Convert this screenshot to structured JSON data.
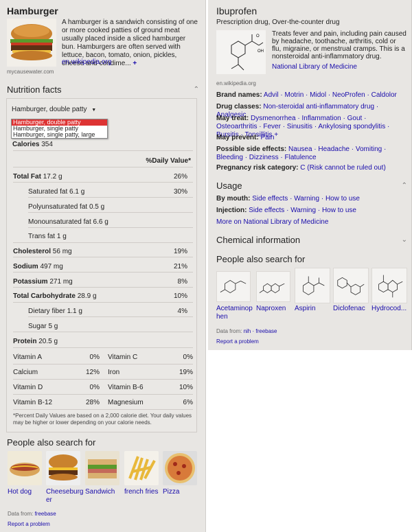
{
  "left": {
    "title": "Hamburger",
    "description": "A hamburger is a sandwich consisting of one or more cooked patties of ground meat usually placed inside a sliced hamburger bun. Hamburgers are often served with lettuce, bacon, tomato, onion, pickles, cheese and condime...",
    "more": "+",
    "image_credit": "mycausewater.com",
    "source_link": "en.wikipedia.org",
    "nutrition_title": "Nutrition facts",
    "serving_selected": "Hamburger, double patty",
    "serving_options": [
      "Hamburger, double patty",
      "Hamburger, single patty",
      "Hamburger, single patty, large"
    ],
    "calories_label": "Calories",
    "calories_value": "354",
    "daily_value_header": "%Daily Value*",
    "rows": [
      {
        "label": "Total Fat",
        "amount": "17.2 g",
        "pct": "26%"
      },
      {
        "label": "Saturated fat",
        "amount": "6.1 g",
        "pct": "30%"
      },
      {
        "label": "Polyunsaturated fat",
        "amount": "0.5 g",
        "pct": ""
      },
      {
        "label": "Monounsaturated fat",
        "amount": "6.6 g",
        "pct": ""
      },
      {
        "label": "Trans fat",
        "amount": "1 g",
        "pct": ""
      },
      {
        "label": "Cholesterol",
        "amount": "56 mg",
        "pct": "19%"
      },
      {
        "label": "Sodium",
        "amount": "497 mg",
        "pct": "21%"
      },
      {
        "label": "Potassium",
        "amount": "271 mg",
        "pct": "8%"
      },
      {
        "label": "Total Carbohydrate",
        "amount": "28.9 g",
        "pct": "10%"
      },
      {
        "label": "Dietary fiber",
        "amount": "1.1 g",
        "pct": "4%"
      },
      {
        "label": "Sugar",
        "amount": "5 g",
        "pct": ""
      },
      {
        "label": "Protein",
        "amount": "20.5 g",
        "pct": ""
      }
    ],
    "vitamins": [
      [
        "Vitamin A",
        "0%",
        "Vitamin C",
        "0%"
      ],
      [
        "Calcium",
        "12%",
        "Iron",
        "19%"
      ],
      [
        "Vitamin D",
        "0%",
        "Vitamin B-6",
        "10%"
      ],
      [
        "Vitamin B-12",
        "28%",
        "Magnesium",
        "6%"
      ]
    ],
    "footnote": "*Percent Daily Values are based on a 2,000 calorie diet. Your daily values may be higher or lower depending on your calorie needs.",
    "people_title": "People also search for",
    "people": [
      "Hot dog",
      "Cheeseburg er",
      "Sandwich",
      "french fries",
      "Pizza"
    ],
    "data_from_label": "Data from:",
    "data_from": "freebase",
    "report": "Report a problem"
  },
  "right": {
    "title": "Ibuprofen",
    "subtitle": "Prescription drug, Over-the-counter drug",
    "description": "Treats fever and pain, including pain caused by headache, toothache, arthritis, cold or flu, migraine, or menstrual cramps. This is a nonsteroidal anti-inflammatory drug.",
    "nlm": "National Library of Medicine",
    "wiki": "en.wikipedia.org",
    "brand_label": "Brand names:",
    "brand": "Advil · Motrin · Midol · NeoProfen · Caldolor",
    "classes_label": "Drug classes:",
    "classes": "Non-steroidal anti-inflammatory drug · Analgesic",
    "treat_label": "May treat:",
    "treat": "Dysmenorrhea · Inflammation · Gout · Osteoarthritis · Fever · Sinusitis · Ankylosing spondylitis · Bursitis · Tonsillitis +",
    "prevent_label": "May prevent:",
    "prevent": "Pain",
    "side_label": "Possible side effects:",
    "side": "Nausea · Headache · Vomiting · Bleeding · Dizziness · Flatulence",
    "preg_label": "Pregnancy risk category:",
    "preg": "C (Risk cannot be ruled out)",
    "usage_title": "Usage",
    "mouth_label": "By mouth:",
    "mouth": "Side effects · Warning · How to use",
    "inj_label": "Injection:",
    "inj": "Side effects · Warning · How to use",
    "more_nlm": "More on National Library of Medicine",
    "chem_title": "Chemical information",
    "people_title": "People also search for",
    "people": [
      "Acetaminop hen",
      "Naproxen",
      "Aspirin",
      "Diclofenac",
      "Hydrocod..."
    ],
    "data_from_label": "Data from:",
    "data_from": "nih · freebase",
    "report": "Report a problem",
    "chevron_up": "⌃",
    "chevron_down": "⌄"
  }
}
